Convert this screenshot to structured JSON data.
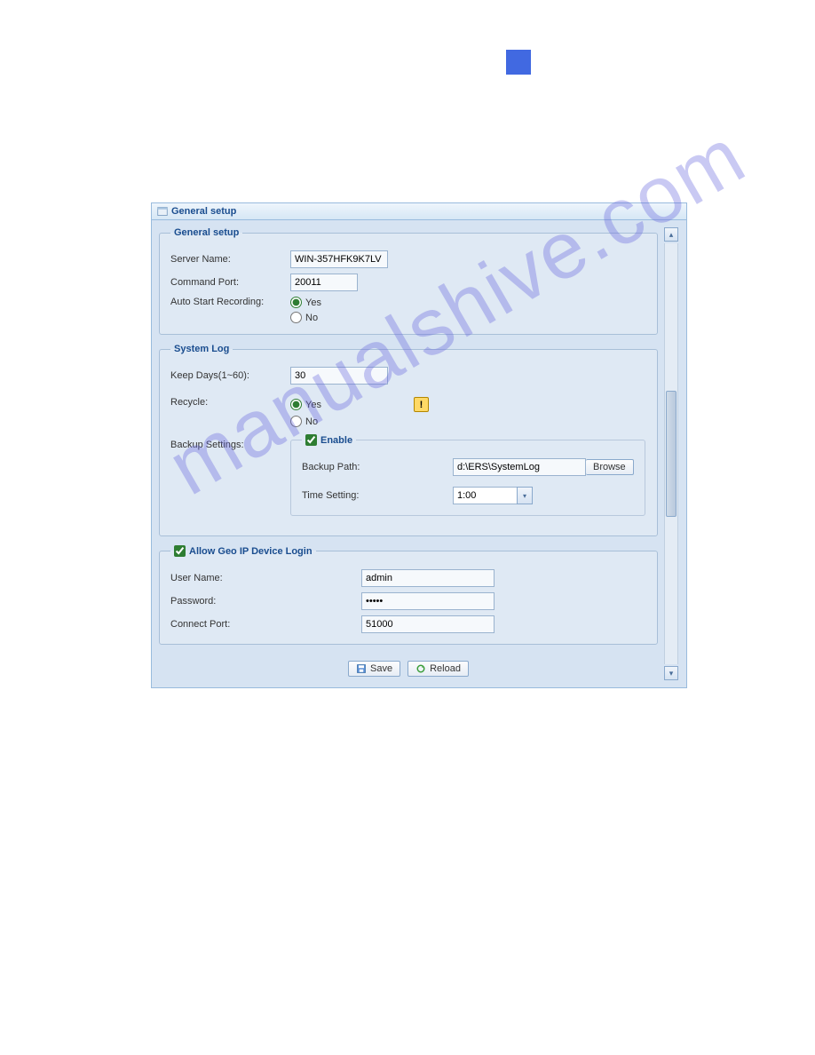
{
  "watermark": "manualshive.com",
  "panel": {
    "title": "General setup"
  },
  "general_setup": {
    "legend": "General setup",
    "server_name_label": "Server Name:",
    "server_name_value": "WIN-357HFK9K7LV",
    "command_port_label": "Command Port:",
    "command_port_value": "20011",
    "auto_start_label": "Auto Start Recording:",
    "yes_label": "Yes",
    "no_label": "No"
  },
  "system_log": {
    "legend": "System Log",
    "keep_days_label": "Keep Days(1~60):",
    "keep_days_value": "30",
    "recycle_label": "Recycle:",
    "yes_label": "Yes",
    "no_label": "No",
    "backup_settings_label": "Backup Settings:",
    "enable_label": "Enable",
    "backup_path_label": "Backup Path:",
    "backup_path_value": "d:\\ERS\\SystemLog",
    "browse_label": "Browse",
    "time_setting_label": "Time Setting:",
    "time_setting_value": "1:00"
  },
  "geo_ip": {
    "legend": "Allow Geo IP Device Login",
    "user_name_label": "User Name:",
    "user_name_value": "admin",
    "password_label": "Password:",
    "password_value": "•••••",
    "connect_port_label": "Connect Port:",
    "connect_port_value": "51000"
  },
  "buttons": {
    "save_label": "Save",
    "reload_label": "Reload"
  }
}
